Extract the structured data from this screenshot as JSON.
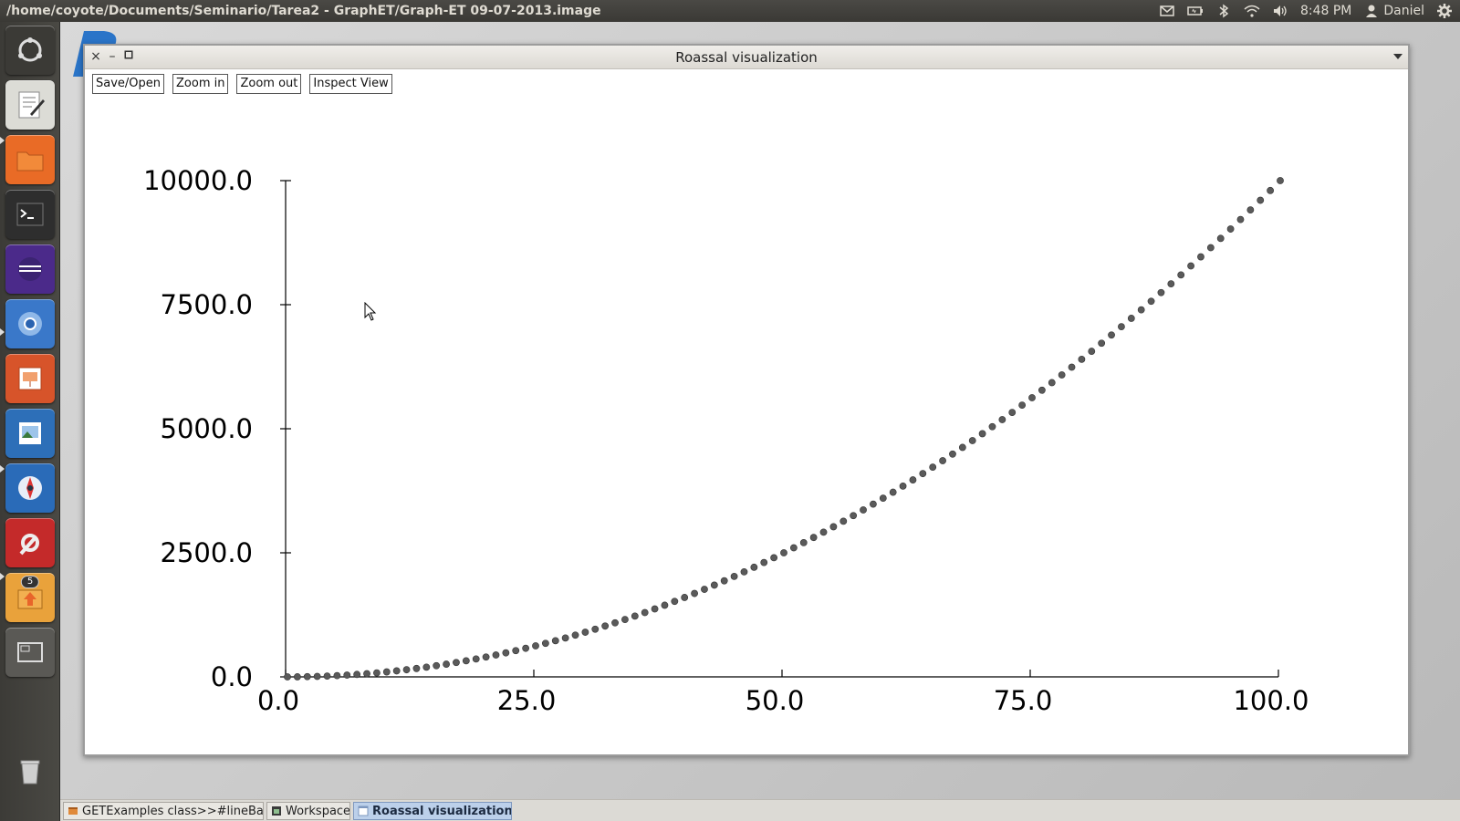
{
  "top_panel": {
    "title": "/home/coyote/Documents/Seminario/Tarea2 - GraphET/Graph-ET 09-07-2013.image",
    "time": "8:48 PM",
    "user": "Daniel",
    "icons": [
      "mail-icon",
      "battery-icon",
      "bluetooth-icon",
      "wifi-icon",
      "volume-icon",
      "user-icon",
      "gear-icon"
    ]
  },
  "launcher": {
    "items": [
      {
        "name": "ubuntu-home-icon",
        "color": "#3b3a36"
      },
      {
        "name": "text-editor-icon",
        "color": "#dcdcd6"
      },
      {
        "name": "files-icon",
        "color": "#e96b26"
      },
      {
        "name": "terminal-icon",
        "color": "#2e2e2e"
      },
      {
        "name": "eclipse-icon",
        "color": "#4b2a8a"
      },
      {
        "name": "chromium-icon",
        "color": "#3a78c9"
      },
      {
        "name": "presentation-icon",
        "color": "#d7542a"
      },
      {
        "name": "image-viewer-icon",
        "color": "#2d6fb8"
      },
      {
        "name": "app-icon",
        "color": "#2a6bb8"
      },
      {
        "name": "settings-icon",
        "color": "#c42a2a"
      },
      {
        "name": "update-manager-icon",
        "color": "#e9a23b"
      },
      {
        "name": "workspace-switcher-icon",
        "color": "#5a5955"
      }
    ],
    "update_badge": "5",
    "trash": "trash-icon"
  },
  "window": {
    "title": "Roassal visualization",
    "toolbar": {
      "save_open": "Save/Open",
      "zoom_in": "Zoom in",
      "zoom_out": "Zoom out",
      "inspect_view": "Inspect View"
    }
  },
  "chart_data": {
    "type": "scatter",
    "title": "",
    "xlabel": "",
    "ylabel": "",
    "xlim": [
      0,
      100
    ],
    "ylim": [
      0,
      10000
    ],
    "x_ticks": [
      "0.0",
      "25.0",
      "50.0",
      "75.0",
      "100.0"
    ],
    "y_ticks": [
      "0.0",
      "2500.0",
      "5000.0",
      "7500.0",
      "10000.0"
    ],
    "series": [
      {
        "x_start": 0,
        "x_end": 100,
        "x_step": 1,
        "function": "y = x^2",
        "color": "#5a5a5a"
      }
    ],
    "grid": false,
    "legend": "none"
  },
  "taskbar": {
    "tasks": [
      {
        "label": "GETExamples class>>#lineBas...",
        "active": false
      },
      {
        "label": "Workspace",
        "active": false
      },
      {
        "label": "Roassal visualization",
        "active": true
      }
    ]
  }
}
